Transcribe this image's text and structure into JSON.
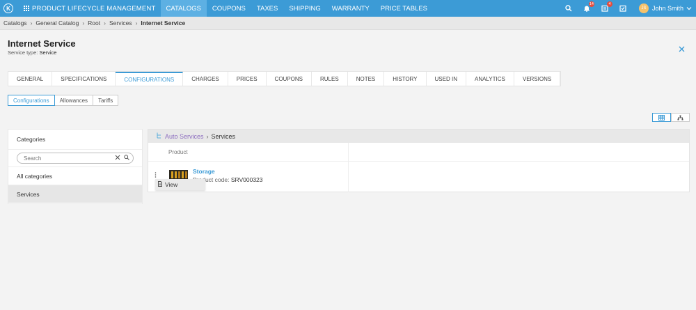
{
  "topbar": {
    "logo": "K",
    "app_title": "PRODUCT LIFECYCLE MANAGEMENT",
    "nav": [
      {
        "label": "CATALOGS",
        "active": true
      },
      {
        "label": "COUPONS"
      },
      {
        "label": "TAXES"
      },
      {
        "label": "SHIPPING"
      },
      {
        "label": "WARRANTY"
      },
      {
        "label": "PRICE TABLES"
      }
    ],
    "notifications_count": "14",
    "tasks_count": "4",
    "avatar_initials": "JS",
    "user_name": "John Smith"
  },
  "breadcrumb": [
    "Catalogs",
    "General Catalog",
    "Root",
    "Services",
    "Internet Service"
  ],
  "header": {
    "title": "Internet Service",
    "subtitle_label": "Service type:",
    "subtitle_value": "Service"
  },
  "tabs": [
    "GENERAL",
    "SPECIFICATIONS",
    "CONFIGURATIONS",
    "CHARGES",
    "PRICES",
    "COUPONS",
    "RULES",
    "NOTES",
    "HISTORY",
    "USED IN",
    "ANALYTICS",
    "VERSIONS"
  ],
  "active_tab": "CONFIGURATIONS",
  "subtabs": [
    "Configurations",
    "Allowances",
    "Tariffs"
  ],
  "active_subtab": "Configurations",
  "categories": {
    "title": "Categories",
    "search_placeholder": "Search",
    "items": [
      "All categories",
      "Services"
    ],
    "selected": "Services"
  },
  "products": {
    "path_link": "Auto Services",
    "path_current": "Services",
    "column_header": "Product",
    "rows": [
      {
        "name": "Storage",
        "code_label": "Product code:",
        "code": "SRV000323"
      }
    ],
    "context_menu": [
      "View"
    ]
  },
  "colors": {
    "accent": "#3c9bd6",
    "topbar": "#3c9bd6",
    "link_purple": "#8e6fc0",
    "badge": "#e74c3c"
  }
}
